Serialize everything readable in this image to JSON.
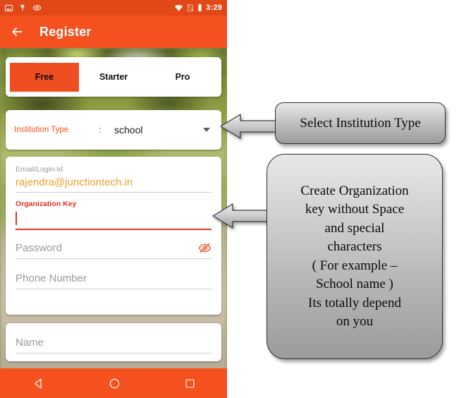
{
  "phone": {
    "status_bar": {
      "time": "3:29",
      "left_icons": [
        "image-icon",
        "android-debug-icon",
        "vpn-icon"
      ],
      "right_icons": [
        "wifi-icon",
        "sim-missing-icon",
        "battery-icon"
      ],
      "background_color": "#e04818"
    },
    "app_bar": {
      "back_icon": "back-arrow-icon",
      "title": "Register",
      "background_color": "#f4511e"
    },
    "plan_tabs": {
      "items": [
        {
          "label": "Free",
          "active": true
        },
        {
          "label": "Starter",
          "active": false
        },
        {
          "label": "Pro",
          "active": false
        }
      ],
      "active_color": "#ef4f20"
    },
    "institution": {
      "label": "Institution Type",
      "separator": ":",
      "value": "school",
      "dropdown_icon": "chevron-down-icon",
      "label_color": "#f4511e"
    },
    "form": {
      "fields": [
        {
          "label": "Email/Login-Id",
          "value": "rajendra@junctiontech.in",
          "placeholder": "",
          "state": "filled",
          "value_color": "#f0a030"
        },
        {
          "label": "Organization Key",
          "value": "",
          "placeholder": "",
          "state": "focused",
          "accent_color": "#e53321"
        },
        {
          "label": "",
          "value": "",
          "placeholder": "Password",
          "state": "empty",
          "trailing_icon": "eye-off-icon"
        },
        {
          "label": "",
          "value": "",
          "placeholder": "Phone Number",
          "state": "empty"
        }
      ],
      "name_field": {
        "label": "",
        "value": "",
        "placeholder": "Name",
        "state": "empty"
      }
    },
    "nav_bar": {
      "icons": [
        "back-triangle-icon",
        "home-circle-icon",
        "recents-square-icon"
      ],
      "background_color": "#f4511e"
    }
  },
  "annotations": {
    "callout_1": {
      "text": "Select Institution Type",
      "arrow": "left-arrow-icon"
    },
    "callout_2": {
      "text": "Create Organization key without Space and special characters ( For example – School name ) Its totally depend on you",
      "lines": [
        "Create Organization",
        "key without Space",
        "and special",
        "characters",
        "( For example –",
        "School name )",
        "Its totally depend",
        "on you"
      ],
      "arrow": "left-arrow-icon"
    }
  }
}
